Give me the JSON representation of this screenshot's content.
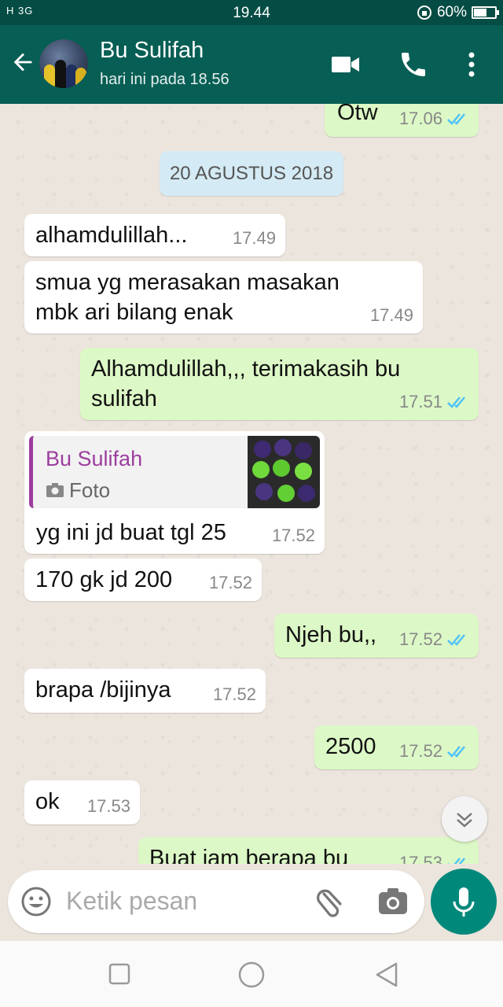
{
  "status_bar": {
    "signal": "H 3G",
    "time": "19.44",
    "battery": "60%",
    "battery_level": 0.6
  },
  "header": {
    "contact_name": "Bu Sulifah",
    "last_seen": "hari ini pada 18.56"
  },
  "chat": {
    "date_separator": "20 AGUSTUS 2018",
    "messages": [
      {
        "text": "Otw",
        "time": "17.06"
      },
      {
        "text": "alhamdulillah...",
        "time": "17.49"
      },
      {
        "text1": "smua yg merasakan masakan",
        "text2": "mbk ari bilang enak",
        "time": "17.49"
      },
      {
        "text1": "Alhamdulillah,,, terimakasih bu",
        "text2": "sulifah",
        "time": "17.51"
      },
      {
        "quote_name": "Bu Sulifah",
        "quote_type": "Foto",
        "text": "yg ini jd buat tgl 25",
        "time": "17.52"
      },
      {
        "text": "170 gk jd 200",
        "time": "17.52"
      },
      {
        "text": "Njeh bu,,",
        "time": "17.52"
      },
      {
        "text": "brapa /bijinya",
        "time": "17.52"
      },
      {
        "text": "2500",
        "time": "17.52"
      },
      {
        "text": "ok",
        "time": "17.53"
      },
      {
        "text": "Buat jam berapa bu",
        "time": "17.53"
      }
    ]
  },
  "input": {
    "placeholder": "Ketik pesan"
  },
  "colors": {
    "header": "#075e54",
    "status_bar": "#054d44",
    "outgoing": "#dcf8c6",
    "incoming": "#ffffff",
    "quote_accent": "#9c3e9e",
    "ticks": "#4fc3f7",
    "mic": "#00897b"
  },
  "icons": [
    "back-arrow-icon",
    "video-call-icon",
    "phone-icon",
    "more-vert-icon",
    "double-check-icon",
    "camera-icon",
    "chevron-double-down-icon",
    "emoji-icon",
    "attach-icon",
    "mic-icon",
    "nav-recent-icon",
    "nav-home-icon",
    "nav-back-icon"
  ]
}
